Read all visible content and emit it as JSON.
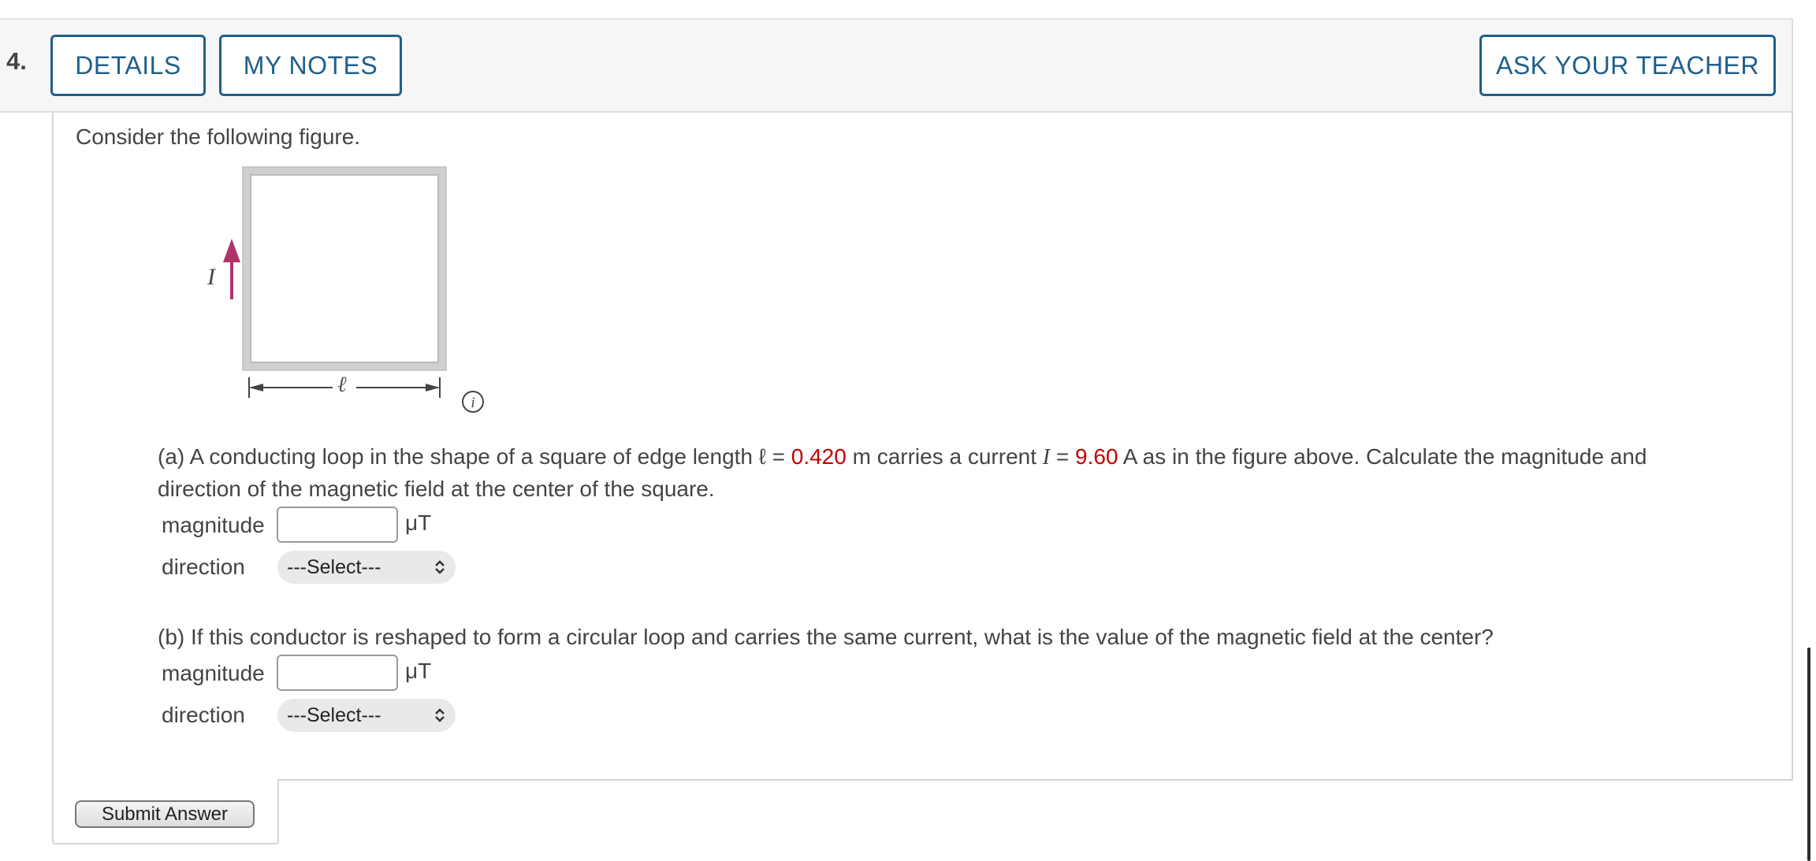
{
  "header": {
    "question_number": "4.",
    "details_label": "DETAILS",
    "notes_label": "MY NOTES",
    "ask_label": "ASK YOUR TEACHER"
  },
  "intro": "Consider the following figure.",
  "figure": {
    "current_label": "I",
    "length_label": "ℓ",
    "info_icon": "info-icon"
  },
  "part_a": {
    "text_1": "(a) A conducting loop in the shape of a square of edge length ℓ = ",
    "edge_value": "0.420",
    "text_2": " m carries a current ",
    "current_symbol": "I",
    "text_3": " = ",
    "current_value": "9.60",
    "text_4": " A as in the figure above. Calculate the magnitude and",
    "text_line2": "direction of the magnetic field at the center of the square.",
    "magnitude_label": "magnitude",
    "magnitude_value": "",
    "unit": "μT",
    "direction_label": "direction",
    "direction_selected": "---Select---"
  },
  "part_b": {
    "text": "(b) If this conductor is reshaped to form a circular loop and carries the same current, what is the value of the magnetic field at the center?",
    "magnitude_label": "magnitude",
    "magnitude_value": "",
    "unit": "μT",
    "direction_label": "direction",
    "direction_selected": "---Select---"
  },
  "submit_label": "Submit Answer",
  "colors": {
    "button_blue": "#1f5f8b",
    "given_value_red": "#c40000",
    "arrow_magenta": "#b0336a"
  }
}
